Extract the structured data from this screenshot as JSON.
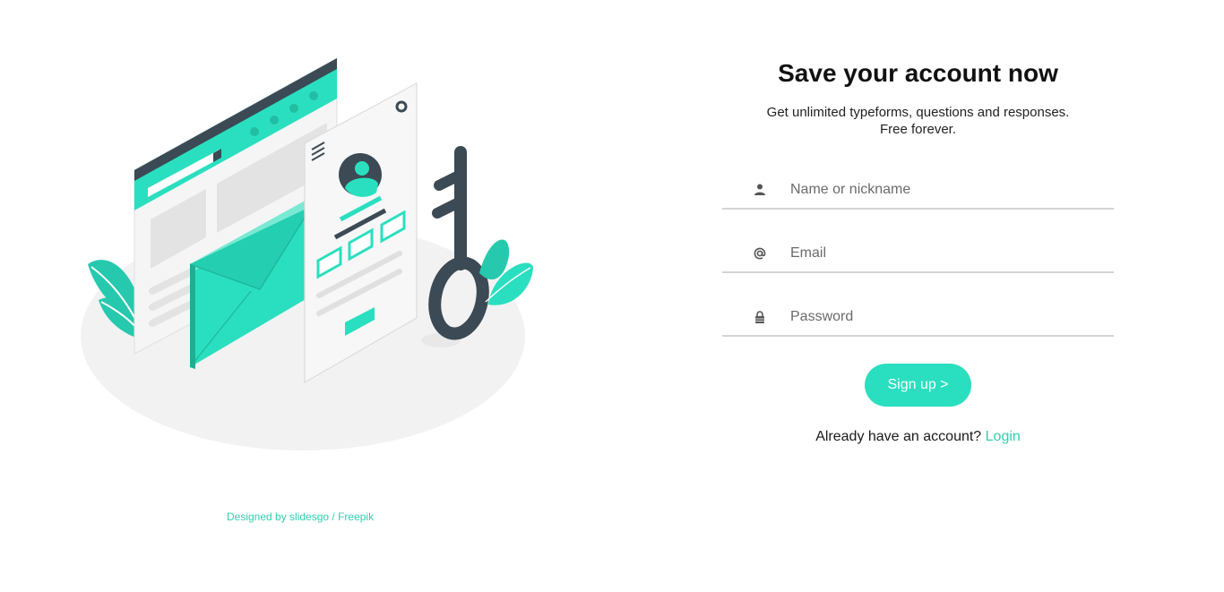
{
  "form": {
    "title": "Save your account now",
    "subtitle_line1": "Get unlimited typeforms, questions and responses.",
    "subtitle_line2": "Free forever.",
    "fields": [
      {
        "icon": "user-icon",
        "placeholder": "Name or nickname",
        "value": ""
      },
      {
        "icon": "at-icon",
        "placeholder": "Email",
        "value": ""
      },
      {
        "icon": "lock-icon",
        "placeholder": "Password",
        "value": ""
      }
    ],
    "signup_label": "Sign up >",
    "login_prompt": "Already have an account?",
    "login_link": "Login"
  },
  "credit": "Designed by slidesgo / Freepik",
  "colors": {
    "accent": "#2adfbf",
    "accent_text": "#2fcfb0",
    "dark": "#3b4a54",
    "underline": "#d4d4d4"
  }
}
